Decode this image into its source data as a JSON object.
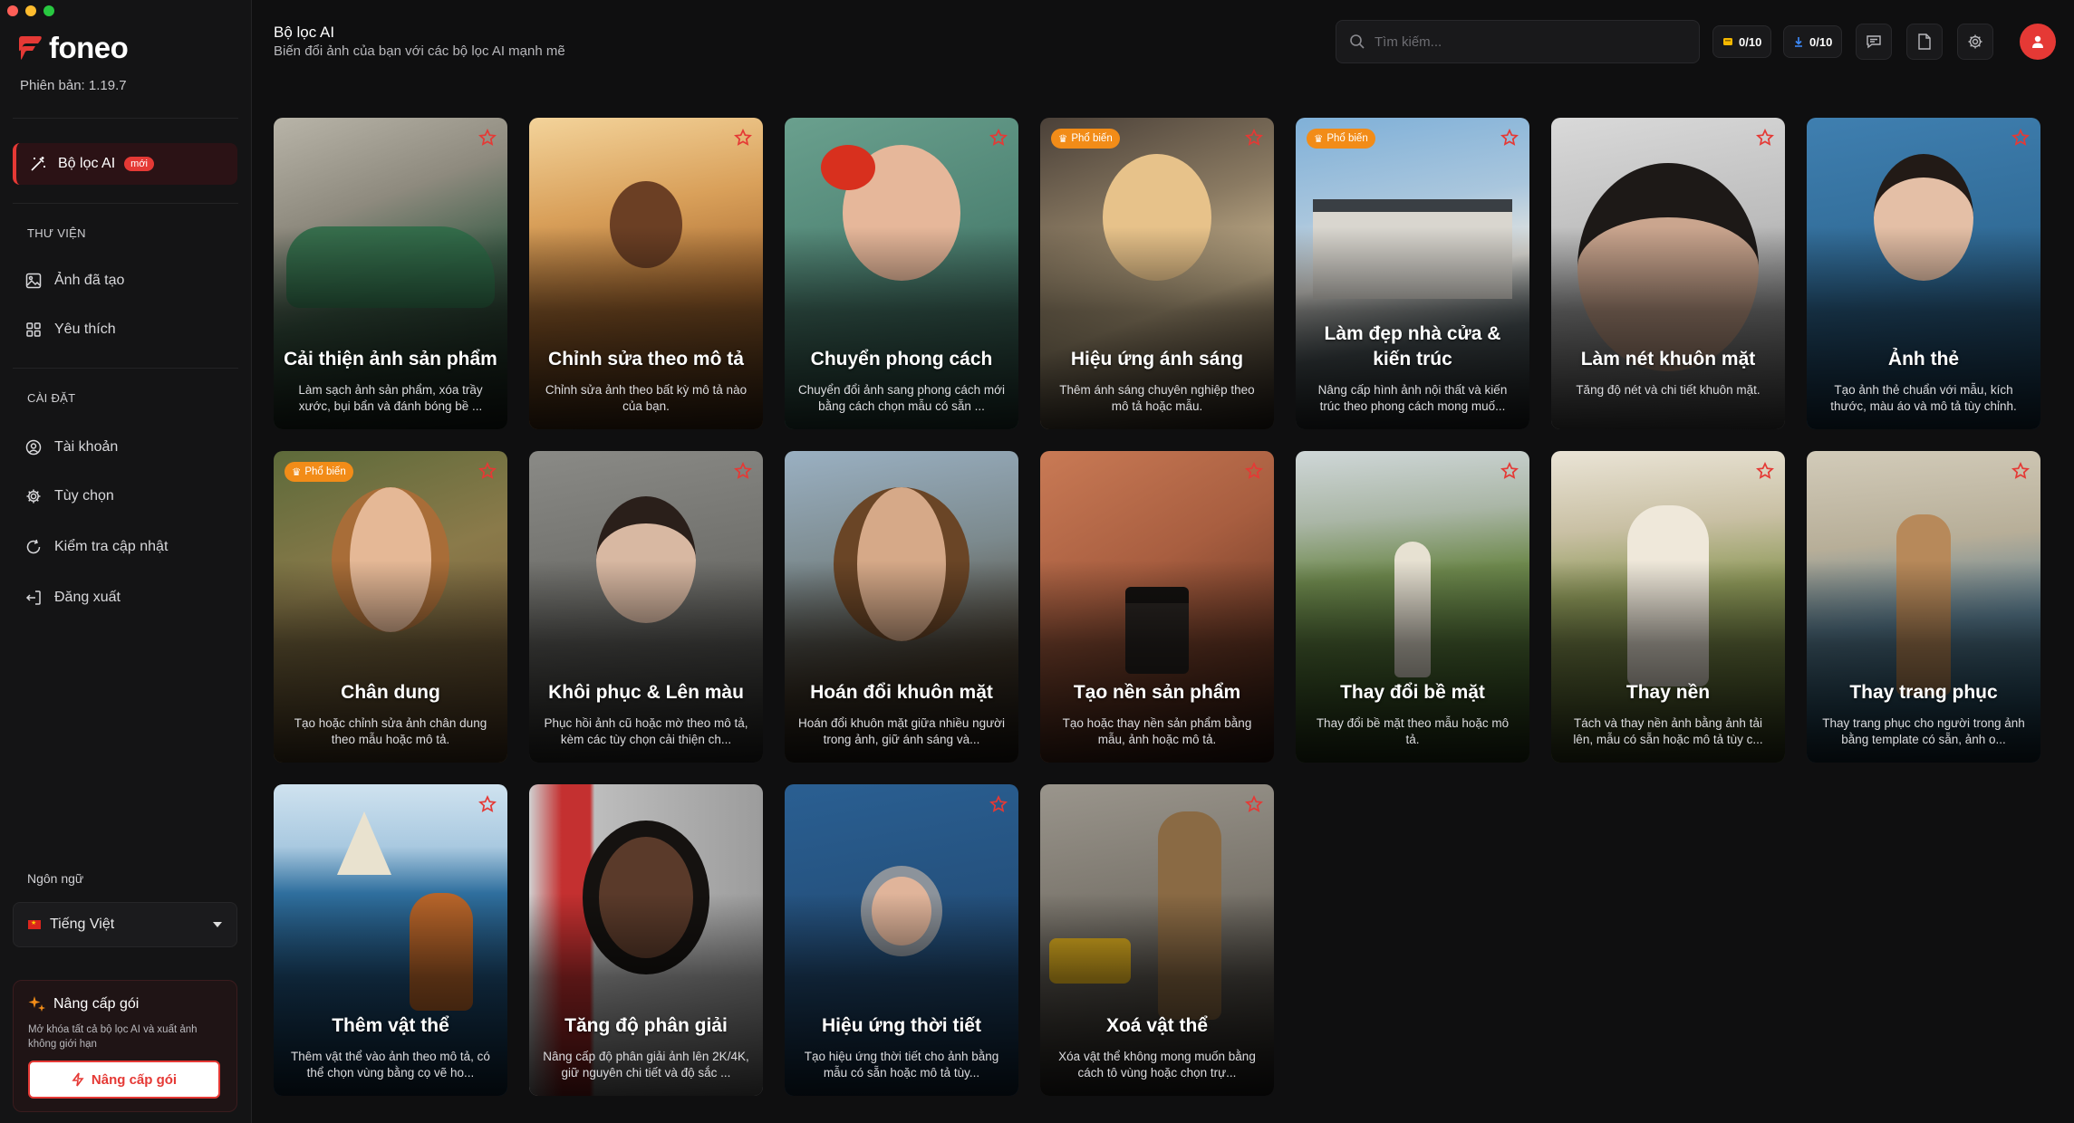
{
  "app": {
    "name": "foneo",
    "version": "Phiên bản: 1.19.7"
  },
  "sidebar": {
    "active_item": {
      "label": "Bộ lọc AI",
      "badge": "mới"
    },
    "library_title": "THƯ VIỆN",
    "library_items": [
      {
        "label": "Ảnh đã tạo",
        "icon": "image-icon"
      },
      {
        "label": "Yêu thích",
        "icon": "grid-icon"
      }
    ],
    "settings_title": "CÀI ĐẶT",
    "settings_items": [
      {
        "label": "Tài khoản",
        "icon": "user-circle-icon"
      },
      {
        "label": "Tùy chọn",
        "icon": "gear-icon"
      },
      {
        "label": "Kiểm tra cập nhật",
        "icon": "refresh-icon"
      },
      {
        "label": "Đăng xuất",
        "icon": "logout-icon"
      }
    ],
    "language_title": "Ngôn ngữ",
    "language_value": "Tiếng Việt",
    "upgrade": {
      "title": "Nâng cấp gói",
      "description": "Mở khóa tất cả bộ lọc AI và xuất ảnh không giới hạn",
      "button": "Nâng cấp gói"
    }
  },
  "header": {
    "title": "Bộ lọc AI",
    "subtitle": "Biến đổi ảnh của bạn với các bộ lọc AI mạnh mẽ",
    "search_placeholder": "Tìm kiếm...",
    "credits": [
      {
        "value": "0/10",
        "icon": "coin-icon",
        "color": "#f5b800"
      },
      {
        "value": "0/10",
        "icon": "download-icon",
        "color": "#3d8bff"
      }
    ]
  },
  "popular_label": "Phổ biến",
  "colors": {
    "accent": "#e53935",
    "popular": "#f28c18"
  },
  "cards": [
    {
      "title": "Cải thiện ảnh sản phẩm",
      "desc": "Làm sạch ảnh sản phẩm, xóa trầy xước, bụi bẩn và đánh bóng bề ...",
      "popular": false
    },
    {
      "title": "Chỉnh sửa theo mô tả",
      "desc": "Chỉnh sửa ảnh theo bất kỳ mô tả nào của bạn.",
      "popular": false
    },
    {
      "title": "Chuyển phong cách",
      "desc": "Chuyển đổi ảnh sang phong cách mới bằng cách chọn mẫu có sẵn ...",
      "popular": false
    },
    {
      "title": "Hiệu ứng ánh sáng",
      "desc": "Thêm ánh sáng chuyên nghiệp theo mô tả hoặc mẫu.",
      "popular": true
    },
    {
      "title": "Làm đẹp nhà cửa & kiến trúc",
      "desc": "Nâng cấp hình ảnh nội thất và kiến trúc theo phong cách mong muố...",
      "popular": true
    },
    {
      "title": "Làm nét khuôn mặt",
      "desc": "Tăng độ nét và chi tiết khuôn mặt.",
      "popular": false
    },
    {
      "title": "Ảnh thẻ",
      "desc": "Tạo ảnh thẻ chuẩn với mẫu, kích thước, màu áo và mô tả tùy chỉnh.",
      "popular": false
    },
    {
      "title": "Chân dung",
      "desc": "Tạo hoặc chỉnh sửa ảnh chân dung theo mẫu hoặc mô tả.",
      "popular": true
    },
    {
      "title": "Khôi phục & Lên màu",
      "desc": "Phục hồi ảnh cũ hoặc mờ theo mô tả, kèm các tùy chọn cải thiện ch...",
      "popular": false
    },
    {
      "title": "Hoán đổi khuôn mặt",
      "desc": "Hoán đổi khuôn mặt giữa nhiều người trong ảnh, giữ ánh sáng và...",
      "popular": false
    },
    {
      "title": "Tạo nền sản phẩm",
      "desc": "Tạo hoặc thay nền sản phẩm bằng mẫu, ảnh hoặc mô tả.",
      "popular": false
    },
    {
      "title": "Thay đổi bề mặt",
      "desc": "Thay đổi bề mặt theo mẫu hoặc mô tả.",
      "popular": false
    },
    {
      "title": "Thay nền",
      "desc": "Tách và thay nền ảnh bằng ảnh tải lên, mẫu có sẵn hoặc mô tả tùy c...",
      "popular": false
    },
    {
      "title": "Thay trang phục",
      "desc": "Thay trang phục cho người trong ảnh bằng template có sẵn, ảnh o...",
      "popular": false
    },
    {
      "title": "Thêm vật thể",
      "desc": "Thêm vật thể vào ảnh theo mô tả, có thể chọn vùng bằng cọ vẽ ho...",
      "popular": false
    },
    {
      "title": "Tăng độ phân giải",
      "desc": "Nâng cấp độ phân giải ảnh lên 2K/4K, giữ nguyên chi tiết và độ sắc ...",
      "popular": false
    },
    {
      "title": "Hiệu ứng thời tiết",
      "desc": "Tạo hiệu ứng thời tiết cho ảnh bằng mẫu có sẵn hoặc mô tả tùy...",
      "popular": false
    },
    {
      "title": "Xoá vật thể",
      "desc": "Xóa vật thể không mong muốn bằng cách tô vùng hoặc chọn trự...",
      "popular": false
    }
  ]
}
